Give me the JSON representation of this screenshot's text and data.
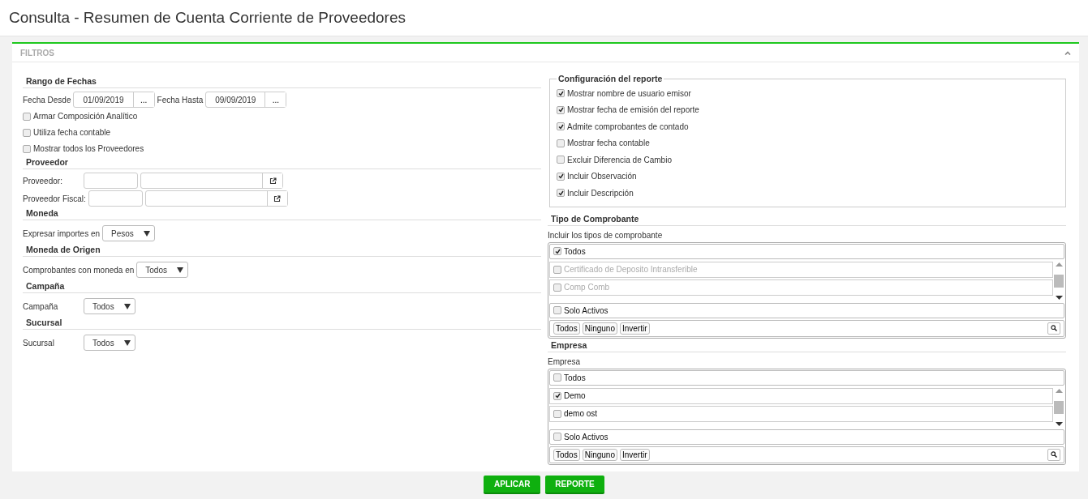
{
  "page_title": "Consulta - Resumen de Cuenta Corriente de Proveedores",
  "panel": {
    "title": "FILTROS"
  },
  "left_sections": [
    {
      "heading": "Rango de Fechas",
      "rows": [
        {
          "kind": "dates",
          "fields": [
            {
              "label": "Fecha Desde",
              "value": "01/09/2019",
              "button": "..."
            },
            {
              "label": "Fecha Hasta",
              "value": "09/09/2019",
              "button": "..."
            }
          ]
        },
        {
          "kind": "checkbox",
          "label": "Armar Composición Analítico",
          "checked": false
        },
        {
          "kind": "checkbox",
          "label": "Utiliza fecha contable",
          "checked": false
        },
        {
          "kind": "checkbox",
          "label": "Mostrar todos los Proveedores",
          "checked": false
        }
      ]
    },
    {
      "heading": "Proveedor",
      "rows": [
        {
          "kind": "lookup",
          "label": "Proveedor:"
        },
        {
          "kind": "lookup",
          "label": "Proveedor Fiscal:"
        }
      ]
    },
    {
      "heading": "Moneda",
      "rows": [
        {
          "kind": "select",
          "label": "Expresar importes en",
          "value": "Pesos"
        }
      ]
    },
    {
      "heading": "Moneda de Origen",
      "rows": [
        {
          "kind": "select",
          "label": "Comprobantes con moneda en",
          "value": "Todos"
        }
      ]
    },
    {
      "heading": "Campaña",
      "rows": [
        {
          "kind": "select",
          "label": "Campaña",
          "value": "Todos"
        }
      ]
    },
    {
      "heading": "Sucursal",
      "rows": [
        {
          "kind": "select",
          "label": "Sucursal",
          "value": "Todos"
        }
      ]
    }
  ],
  "report_config": {
    "legend": "Configuración del reporte",
    "options": [
      {
        "label": "Mostrar nombre de usuario emisor",
        "checked": true
      },
      {
        "label": "Mostrar fecha de emisión del reporte",
        "checked": true
      },
      {
        "label": "Admite comprobantes de contado",
        "checked": true
      },
      {
        "label": "Mostrar fecha contable",
        "checked": false
      },
      {
        "label": "Excluir Diferencia de Cambio",
        "checked": false
      },
      {
        "label": "Incluir Observación",
        "checked": true
      },
      {
        "label": "Incluir Descripción",
        "checked": true
      }
    ]
  },
  "pickers": [
    {
      "heading": "Tipo de Comprobante",
      "caption": "Incluir los tipos de comprobante",
      "all": {
        "label": "Todos",
        "checked": true
      },
      "items": [
        {
          "label": "Certificado de Deposito Intransferible",
          "checked": false,
          "disabled": true
        },
        {
          "label": "Comp Comb",
          "checked": false,
          "disabled": true
        }
      ],
      "solo": {
        "label": "Solo Activos",
        "checked": false
      },
      "actions": [
        "Todos",
        "Ninguno",
        "Invertir"
      ]
    },
    {
      "heading": "Empresa",
      "caption": "Empresa",
      "all": {
        "label": "Todos",
        "checked": false
      },
      "items": [
        {
          "label": "Demo",
          "checked": true,
          "disabled": false
        },
        {
          "label": "demo ost",
          "checked": false,
          "disabled": false
        }
      ],
      "solo": {
        "label": "Solo Activos",
        "checked": false
      },
      "actions": [
        "Todos",
        "Ninguno",
        "Invertir"
      ]
    }
  ],
  "buttons": [
    "APLICAR",
    "REPORTE"
  ]
}
